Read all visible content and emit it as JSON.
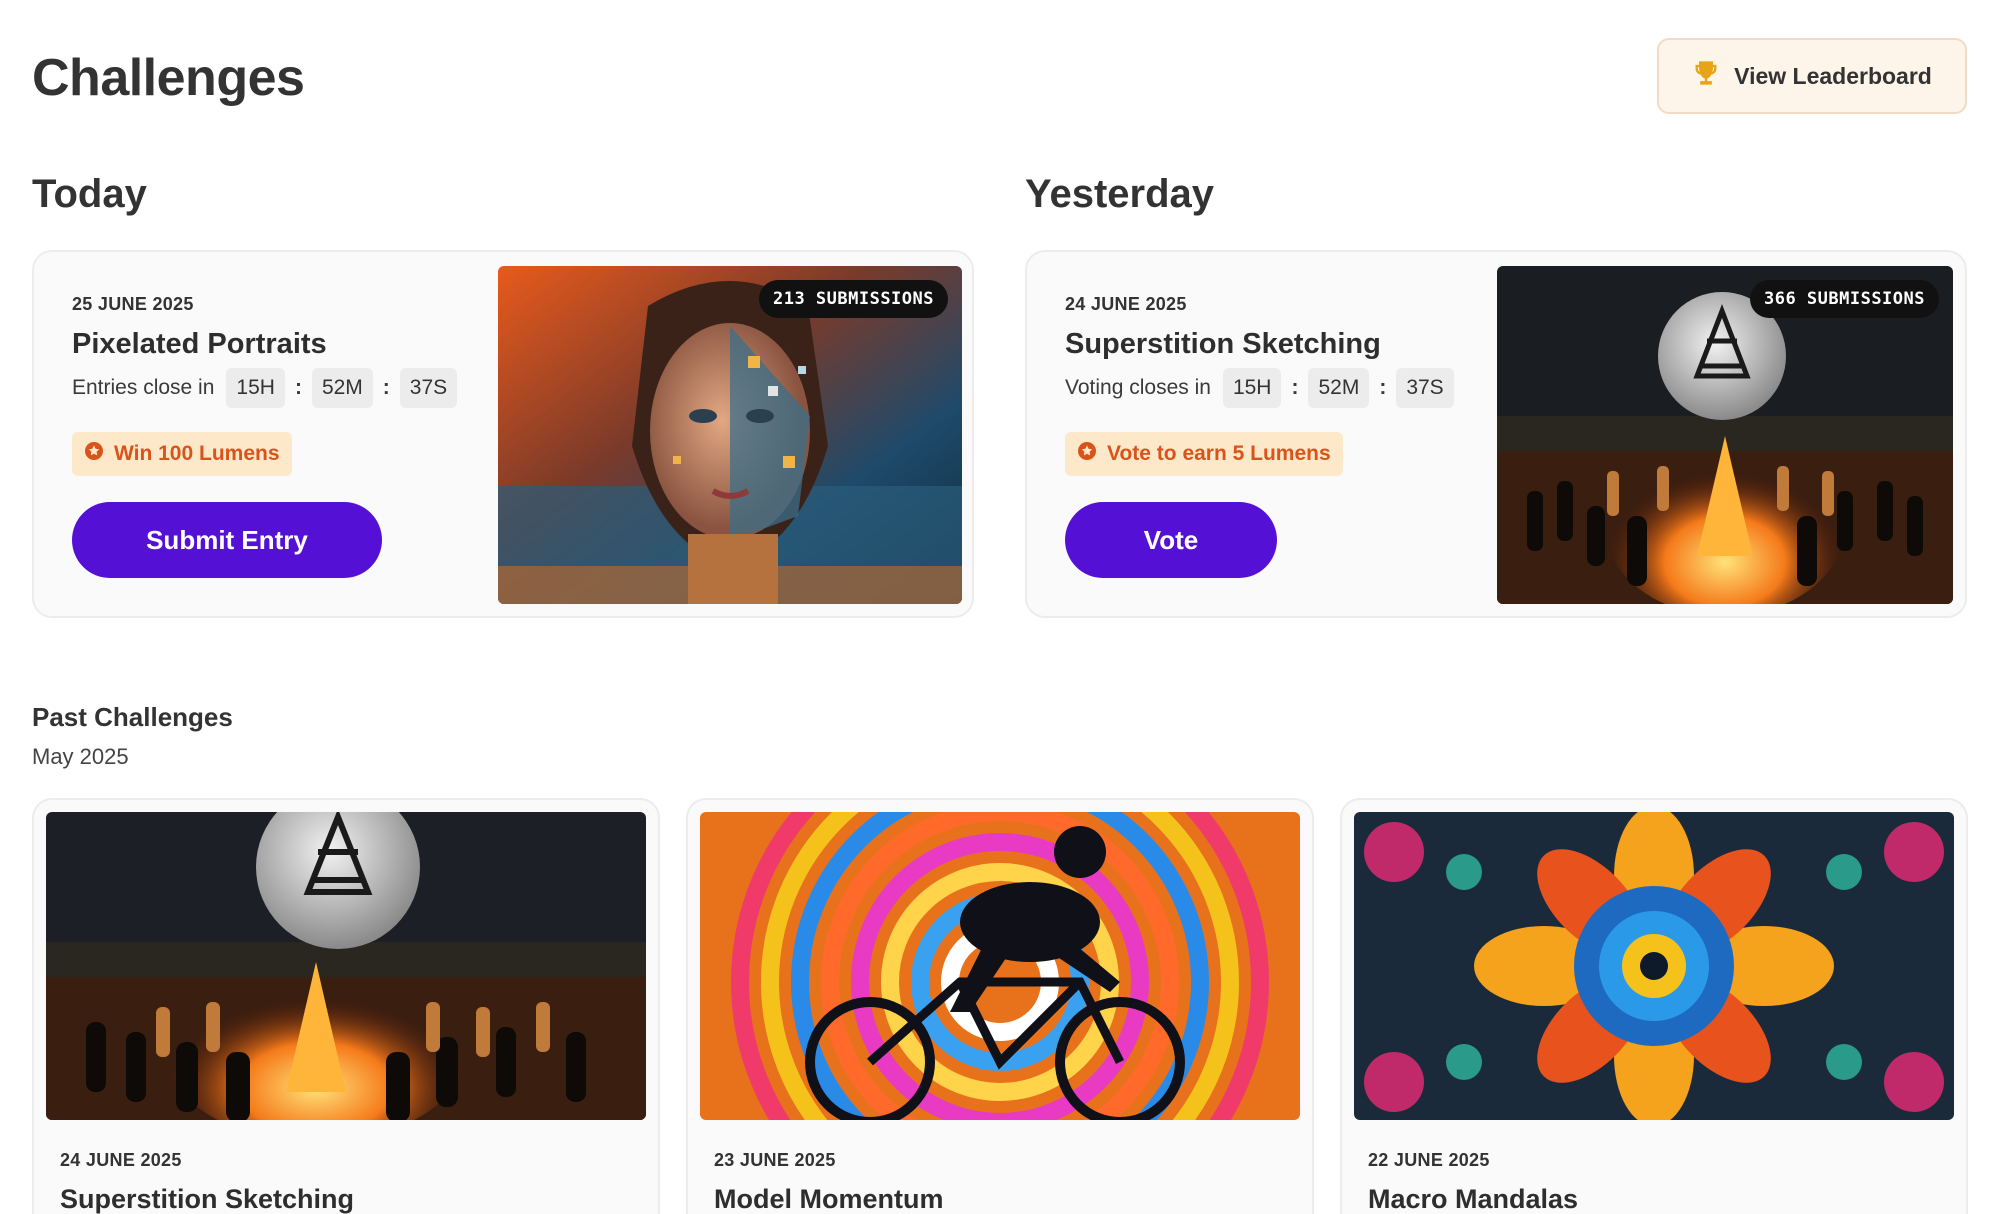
{
  "header": {
    "title": "Challenges",
    "leaderboard_label": "View Leaderboard"
  },
  "today": {
    "section_label": "Today",
    "date": "25 JUNE 2025",
    "title": "Pixelated Portraits",
    "timer_label": "Entries close in",
    "hours": "15H",
    "minutes": "52M",
    "seconds": "37S",
    "reward": "Win 100 Lumens",
    "button": "Submit Entry",
    "submissions": "213 SUBMISSIONS"
  },
  "yesterday": {
    "section_label": "Yesterday",
    "date": "24 JUNE 2025",
    "title": "Superstition Sketching",
    "timer_label": "Voting closes in",
    "hours": "15H",
    "minutes": "52M",
    "seconds": "37S",
    "reward": "Vote to earn 5 Lumens",
    "button": "Vote",
    "submissions": "366 SUBMISSIONS"
  },
  "past": {
    "title": "Past Challenges",
    "month": "May 2025",
    "items": [
      {
        "date": "24 JUNE 2025",
        "title": "Superstition Sketching"
      },
      {
        "date": "23 JUNE 2025",
        "title": "Model Momentum"
      },
      {
        "date": "22 JUNE 2025",
        "title": "Macro Mandalas"
      }
    ]
  },
  "colors": {
    "primary": "#5510d6",
    "reward_bg": "#fde8c9",
    "reward_text": "#d9541a",
    "leaderboard_bg": "#fdf4ea",
    "trophy": "#e8a317"
  },
  "icons": {
    "leaderboard": "trophy-icon",
    "reward": "lumen-icon"
  }
}
